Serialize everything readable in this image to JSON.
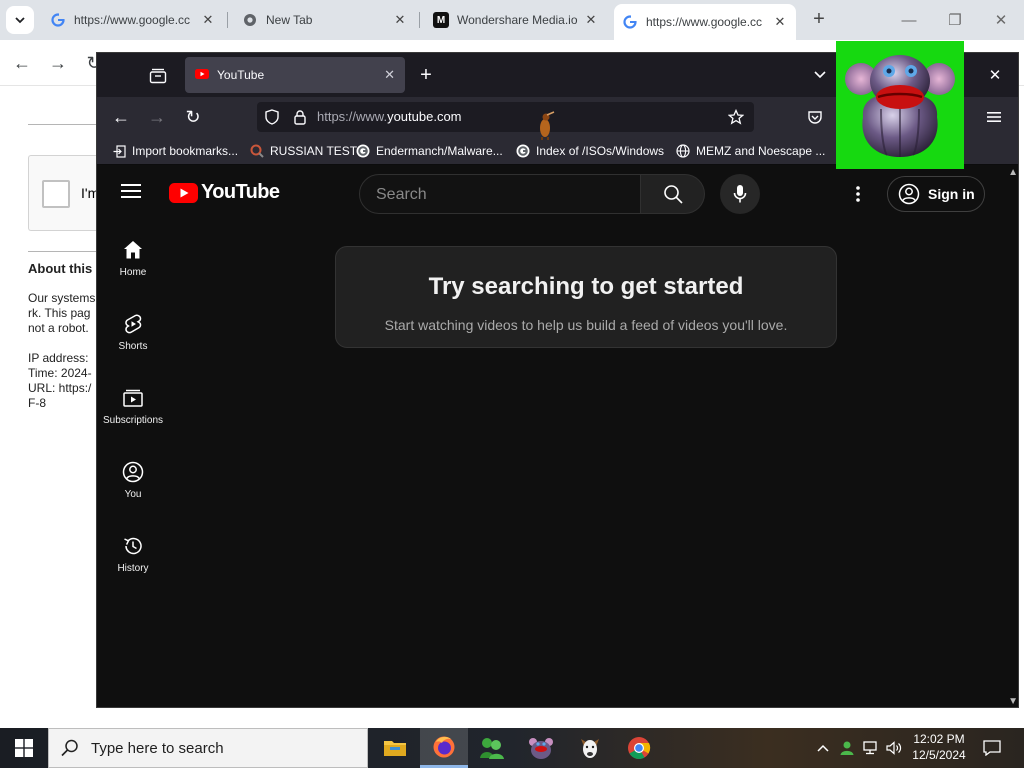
{
  "chrome": {
    "tabs": [
      {
        "title": "https://www.google.cc",
        "favicon": "google-g-icon",
        "active": false
      },
      {
        "title": "New Tab",
        "favicon": "chrome-icon",
        "active": false
      },
      {
        "title": "Wondershare Media.io",
        "favicon": "media-io-icon",
        "active": false
      },
      {
        "title": "https://www.google.cc",
        "favicon": "google-g-icon",
        "active": true
      }
    ],
    "page": {
      "captcha_label": "I'm",
      "about_title": "About this",
      "about_lines": [
        "Our systems",
        "rk. This pag",
        "not a robot."
      ],
      "info_lines": [
        "IP address:",
        "Time: 2024-",
        "URL: https:/",
        "F-8"
      ]
    }
  },
  "firefox": {
    "tab_title": "YouTube",
    "url_prefix": "https://www.",
    "url_domain": "youtube.com",
    "bookmarks": [
      {
        "label": "Import bookmarks...",
        "icon": "import-icon"
      },
      {
        "label": "RUSSIAN TEST",
        "icon": "search-favicon"
      },
      {
        "label": "Endermanch/Malware...",
        "icon": "google-g-icon"
      },
      {
        "label": "Index of /ISOs/Windows",
        "icon": "google-g-icon"
      },
      {
        "label": "MEMZ and Noescape ...",
        "icon": "globe-icon"
      }
    ]
  },
  "youtube": {
    "logo_text": "YouTube",
    "search_placeholder": "Search",
    "sign_in": "Sign in",
    "nav": [
      {
        "label": "Home",
        "icon": "home-icon"
      },
      {
        "label": "Shorts",
        "icon": "shorts-icon"
      },
      {
        "label": "Subscriptions",
        "icon": "subscriptions-icon"
      },
      {
        "label": "You",
        "icon": "you-icon"
      },
      {
        "label": "History",
        "icon": "history-icon"
      }
    ],
    "empty_title": "Try searching to get started",
    "empty_subtitle": "Start watching videos to help us build a feed of videos you'll love."
  },
  "taskbar": {
    "search_placeholder": "Type here to search",
    "time": "12:02 PM",
    "date": "12/5/2024",
    "apps": [
      "file-explorer-icon",
      "firefox-icon",
      "bonzi-buddy-icon",
      "purple-monster-icon",
      "dog-icon",
      "chrome-icon"
    ]
  },
  "colors": {
    "youtube_red": "#ff0000",
    "overlay_green": "#16d910",
    "firefox_chrome": "#2b2a33",
    "youtube_bg": "#0f0f0f"
  }
}
